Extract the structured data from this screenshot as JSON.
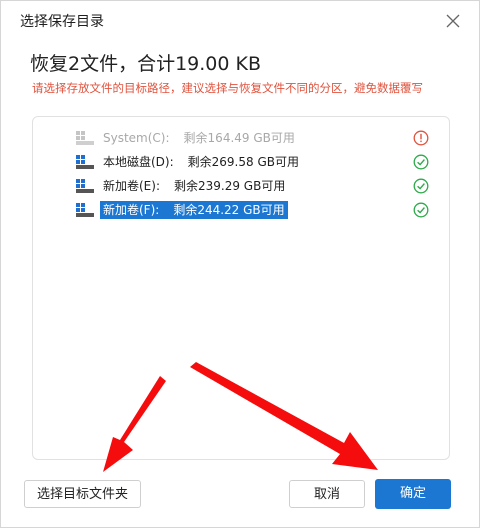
{
  "dialog": {
    "title": "选择保存目录",
    "close_label": "关闭",
    "headline": "恢复2文件，合计19.00 KB",
    "hint": "请选择存放文件的目标路径，建议选择与恢复文件不同的分区，避免数据覆写"
  },
  "drives": [
    {
      "name": "System(C):",
      "free": "剩余164.49 GB可用",
      "state": "disabled",
      "status_icon": "warning-icon"
    },
    {
      "name": "本地磁盘(D):",
      "free": "剩余269.58 GB可用",
      "state": "ok",
      "status_icon": "check-icon"
    },
    {
      "name": "新加卷(E):",
      "free": "剩余239.29 GB可用",
      "state": "ok",
      "status_icon": "check-icon"
    },
    {
      "name": "新加卷(F):",
      "free": "剩余244.22 GB可用",
      "state": "selected",
      "status_icon": "check-icon"
    }
  ],
  "buttons": {
    "select_folder": "选择目标文件夹",
    "cancel": "取消",
    "ok": "确定"
  },
  "colors": {
    "accent": "#1b77d2",
    "hint_red": "#e0533e",
    "check_green": "#2eaa4a",
    "warning_red": "#e0533e",
    "annotation_arrow": "#f50c0c"
  }
}
